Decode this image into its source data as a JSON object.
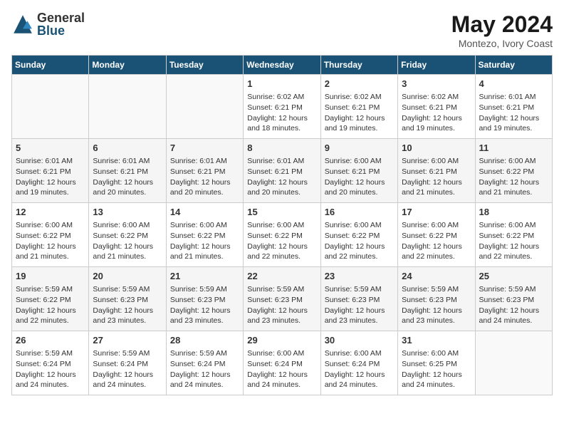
{
  "header": {
    "logo_general": "General",
    "logo_blue": "Blue",
    "month": "May 2024",
    "location": "Montezo, Ivory Coast"
  },
  "days_of_week": [
    "Sunday",
    "Monday",
    "Tuesday",
    "Wednesday",
    "Thursday",
    "Friday",
    "Saturday"
  ],
  "weeks": [
    [
      {
        "day": "",
        "info": ""
      },
      {
        "day": "",
        "info": ""
      },
      {
        "day": "",
        "info": ""
      },
      {
        "day": "1",
        "info": "Sunrise: 6:02 AM\nSunset: 6:21 PM\nDaylight: 12 hours\nand 18 minutes."
      },
      {
        "day": "2",
        "info": "Sunrise: 6:02 AM\nSunset: 6:21 PM\nDaylight: 12 hours\nand 19 minutes."
      },
      {
        "day": "3",
        "info": "Sunrise: 6:02 AM\nSunset: 6:21 PM\nDaylight: 12 hours\nand 19 minutes."
      },
      {
        "day": "4",
        "info": "Sunrise: 6:01 AM\nSunset: 6:21 PM\nDaylight: 12 hours\nand 19 minutes."
      }
    ],
    [
      {
        "day": "5",
        "info": "Sunrise: 6:01 AM\nSunset: 6:21 PM\nDaylight: 12 hours\nand 19 minutes."
      },
      {
        "day": "6",
        "info": "Sunrise: 6:01 AM\nSunset: 6:21 PM\nDaylight: 12 hours\nand 20 minutes."
      },
      {
        "day": "7",
        "info": "Sunrise: 6:01 AM\nSunset: 6:21 PM\nDaylight: 12 hours\nand 20 minutes."
      },
      {
        "day": "8",
        "info": "Sunrise: 6:01 AM\nSunset: 6:21 PM\nDaylight: 12 hours\nand 20 minutes."
      },
      {
        "day": "9",
        "info": "Sunrise: 6:00 AM\nSunset: 6:21 PM\nDaylight: 12 hours\nand 20 minutes."
      },
      {
        "day": "10",
        "info": "Sunrise: 6:00 AM\nSunset: 6:21 PM\nDaylight: 12 hours\nand 21 minutes."
      },
      {
        "day": "11",
        "info": "Sunrise: 6:00 AM\nSunset: 6:22 PM\nDaylight: 12 hours\nand 21 minutes."
      }
    ],
    [
      {
        "day": "12",
        "info": "Sunrise: 6:00 AM\nSunset: 6:22 PM\nDaylight: 12 hours\nand 21 minutes."
      },
      {
        "day": "13",
        "info": "Sunrise: 6:00 AM\nSunset: 6:22 PM\nDaylight: 12 hours\nand 21 minutes."
      },
      {
        "day": "14",
        "info": "Sunrise: 6:00 AM\nSunset: 6:22 PM\nDaylight: 12 hours\nand 21 minutes."
      },
      {
        "day": "15",
        "info": "Sunrise: 6:00 AM\nSunset: 6:22 PM\nDaylight: 12 hours\nand 22 minutes."
      },
      {
        "day": "16",
        "info": "Sunrise: 6:00 AM\nSunset: 6:22 PM\nDaylight: 12 hours\nand 22 minutes."
      },
      {
        "day": "17",
        "info": "Sunrise: 6:00 AM\nSunset: 6:22 PM\nDaylight: 12 hours\nand 22 minutes."
      },
      {
        "day": "18",
        "info": "Sunrise: 6:00 AM\nSunset: 6:22 PM\nDaylight: 12 hours\nand 22 minutes."
      }
    ],
    [
      {
        "day": "19",
        "info": "Sunrise: 5:59 AM\nSunset: 6:22 PM\nDaylight: 12 hours\nand 22 minutes."
      },
      {
        "day": "20",
        "info": "Sunrise: 5:59 AM\nSunset: 6:23 PM\nDaylight: 12 hours\nand 23 minutes."
      },
      {
        "day": "21",
        "info": "Sunrise: 5:59 AM\nSunset: 6:23 PM\nDaylight: 12 hours\nand 23 minutes."
      },
      {
        "day": "22",
        "info": "Sunrise: 5:59 AM\nSunset: 6:23 PM\nDaylight: 12 hours\nand 23 minutes."
      },
      {
        "day": "23",
        "info": "Sunrise: 5:59 AM\nSunset: 6:23 PM\nDaylight: 12 hours\nand 23 minutes."
      },
      {
        "day": "24",
        "info": "Sunrise: 5:59 AM\nSunset: 6:23 PM\nDaylight: 12 hours\nand 23 minutes."
      },
      {
        "day": "25",
        "info": "Sunrise: 5:59 AM\nSunset: 6:23 PM\nDaylight: 12 hours\nand 24 minutes."
      }
    ],
    [
      {
        "day": "26",
        "info": "Sunrise: 5:59 AM\nSunset: 6:24 PM\nDaylight: 12 hours\nand 24 minutes."
      },
      {
        "day": "27",
        "info": "Sunrise: 5:59 AM\nSunset: 6:24 PM\nDaylight: 12 hours\nand 24 minutes."
      },
      {
        "day": "28",
        "info": "Sunrise: 5:59 AM\nSunset: 6:24 PM\nDaylight: 12 hours\nand 24 minutes."
      },
      {
        "day": "29",
        "info": "Sunrise: 6:00 AM\nSunset: 6:24 PM\nDaylight: 12 hours\nand 24 minutes."
      },
      {
        "day": "30",
        "info": "Sunrise: 6:00 AM\nSunset: 6:24 PM\nDaylight: 12 hours\nand 24 minutes."
      },
      {
        "day": "31",
        "info": "Sunrise: 6:00 AM\nSunset: 6:25 PM\nDaylight: 12 hours\nand 24 minutes."
      },
      {
        "day": "",
        "info": ""
      }
    ]
  ]
}
